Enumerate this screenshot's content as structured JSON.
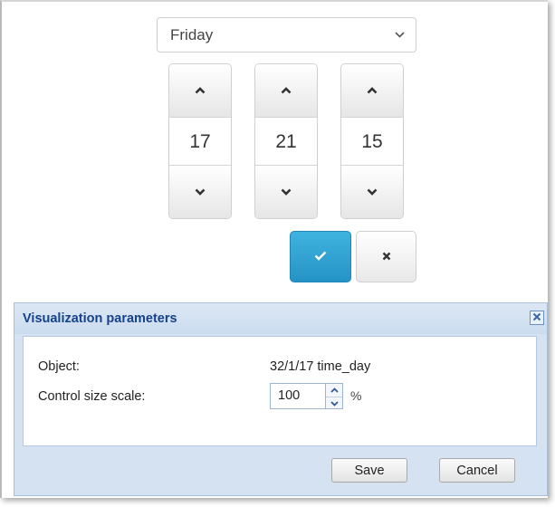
{
  "picker": {
    "day": "Friday",
    "hours": "17",
    "minutes": "21",
    "seconds": "15",
    "confirm_icon": "check-icon",
    "cancel_icon": "close-icon",
    "accent_color": "#2b9fd4"
  },
  "dialog": {
    "title": "Visualization parameters",
    "object_label": "Object:",
    "object_value": "32/1/17 time_day",
    "scale_label": "Control size scale:",
    "scale_value": "100",
    "scale_unit": "%",
    "save_label": "Save",
    "cancel_label": "Cancel",
    "title_color": "#15428b",
    "header_bg": "#d5e2f1"
  }
}
